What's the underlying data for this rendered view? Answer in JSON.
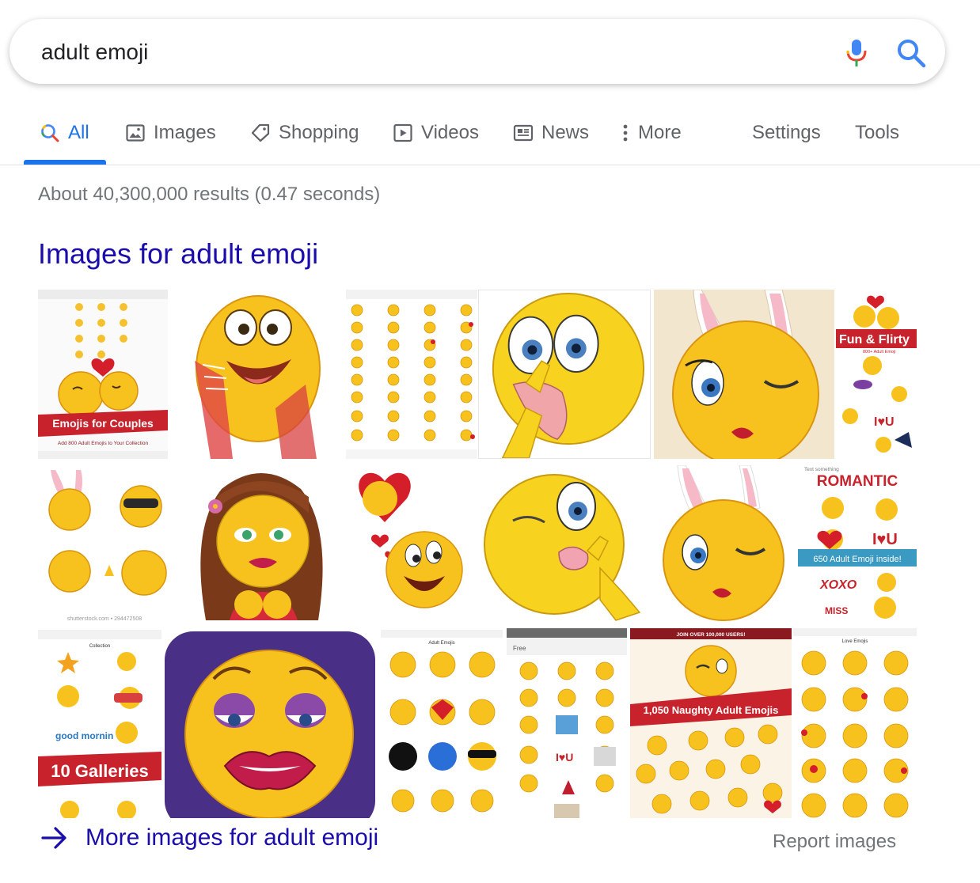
{
  "search": {
    "query": "adult emoji"
  },
  "tabs": {
    "all": "All",
    "images": "Images",
    "shopping": "Shopping",
    "videos": "Videos",
    "news": "News",
    "more": "More",
    "settings": "Settings",
    "tools": "Tools"
  },
  "result_stats": "About 40,300,000 results (0.47 seconds)",
  "images_section": {
    "heading": "Images for adult emoji",
    "thumb_texts": {
      "couples_banner": "Emojis for Couples",
      "couples_sub": "Add 800 Adult Emojis to Your Collection",
      "fun_flirty": "Fun & Flirty",
      "fun_flirty_sub": "800+ Adult Emoji",
      "i_love_u": "I♥U",
      "shutterstock": "shutterstock.com • 294472508",
      "romantic_top": "Text something",
      "romantic": "ROMANTIC",
      "romantic_banner": "650 Adult Emoji inside!",
      "xoxo": "XOXO",
      "miss": "MISS",
      "galleries": "10 Galleries",
      "gallery_header": "Collection",
      "good_morning": "good mornin",
      "adult_emojis_header": "Adult Emojis",
      "free_header": "Free",
      "join_over": "JOIN OVER 100,000 USERS!",
      "naughty_banner": "1,050 Naughty Adult Emojis",
      "love_emojis_header": "Love Emojis"
    },
    "more_link": "More images for adult emoji",
    "report_link": "Report images"
  },
  "colors": {
    "link": "#1a0dab",
    "accent": "#1a73e8",
    "emoji_yellow": "#f7c21e",
    "banner_red": "#c8232c"
  }
}
